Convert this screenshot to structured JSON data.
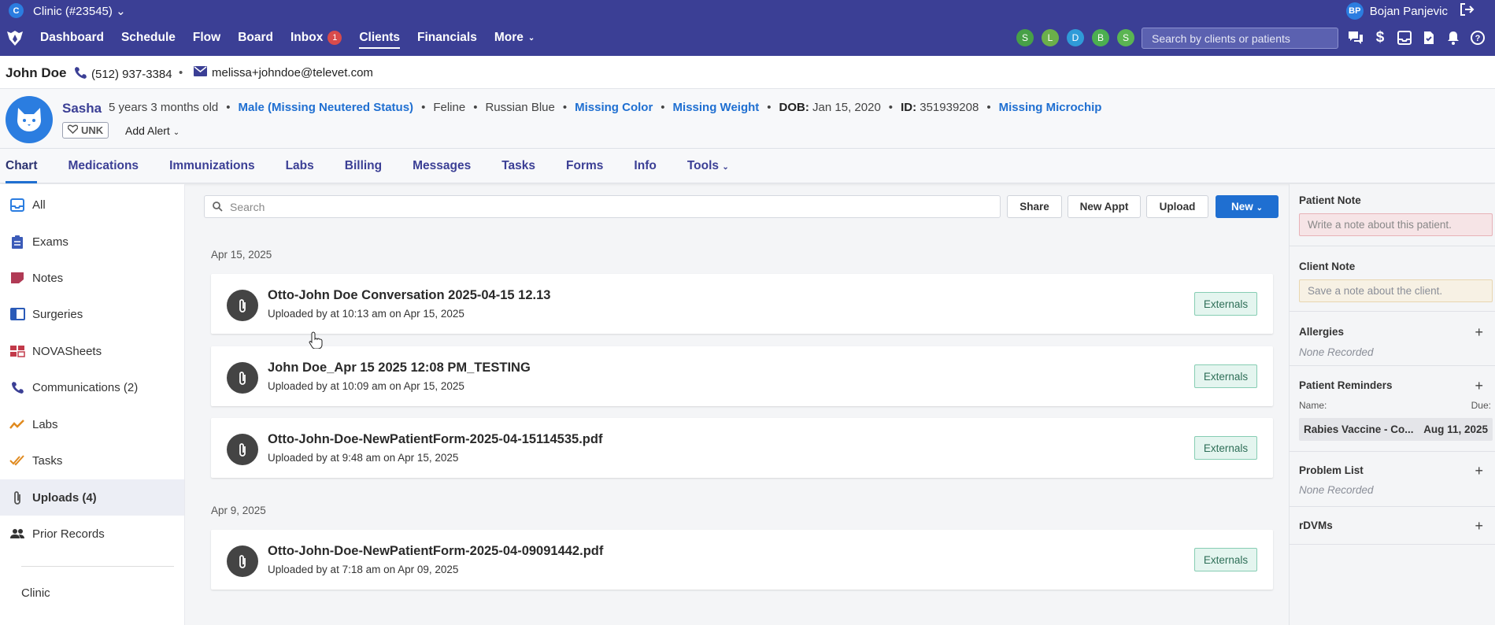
{
  "clinic": {
    "badge": "C",
    "name": "Clinic (#23545)",
    "caret": "⌄"
  },
  "user": {
    "initials": "BP",
    "name": "Bojan Panjevic"
  },
  "nav": {
    "items": [
      "Dashboard",
      "Schedule",
      "Flow",
      "Board",
      "Inbox",
      "Clients",
      "Financials",
      "More"
    ],
    "inbox_count": "1",
    "active": "Clients"
  },
  "staff": [
    {
      "initial": "S",
      "color": "#47a047"
    },
    {
      "initial": "L",
      "color": "#6bb04a"
    },
    {
      "initial": "D",
      "color": "#2f9bd8"
    },
    {
      "initial": "B",
      "color": "#4caf50"
    },
    {
      "initial": "S",
      "color": "#5ab552"
    }
  ],
  "global_search": {
    "placeholder": "Search by clients or patients"
  },
  "client": {
    "name": "John Doe",
    "phone": "(512) 937-3384",
    "email": "melissa+johndoe@televet.com"
  },
  "patient": {
    "name": "Sasha",
    "age": "5 years 3 months old",
    "sex": "Male (Missing Neutered Status)",
    "species": "Feline",
    "breed": "Russian Blue",
    "color": "Missing Color",
    "weight": "Missing Weight",
    "dob_label": "DOB:",
    "dob": "Jan 15, 2020",
    "id_label": "ID:",
    "id": "351939208",
    "microchip": "Missing Microchip",
    "unk": "UNK",
    "add_alert": "Add Alert"
  },
  "tabs": [
    "Chart",
    "Medications",
    "Immunizations",
    "Labs",
    "Billing",
    "Messages",
    "Tasks",
    "Forms",
    "Info",
    "Tools"
  ],
  "sidebar": {
    "items": [
      {
        "label": "All",
        "icon": "inbox-icon"
      },
      {
        "label": "Exams",
        "icon": "clipboard-icon"
      },
      {
        "label": "Notes",
        "icon": "note-icon"
      },
      {
        "label": "Surgeries",
        "icon": "surgery-icon"
      },
      {
        "label": "NOVASheets",
        "icon": "sheets-icon"
      },
      {
        "label": "Communications (2)",
        "icon": "phone-icon"
      },
      {
        "label": "Labs",
        "icon": "labs-chart-icon"
      },
      {
        "label": "Tasks",
        "icon": "double-check-icon"
      },
      {
        "label": "Uploads (4)",
        "icon": "paperclip-icon"
      },
      {
        "label": "Prior Records",
        "icon": "people-icon"
      }
    ],
    "footer": "Clinic"
  },
  "main": {
    "search_placeholder": "Search",
    "buttons": {
      "share": "Share",
      "new_appt": "New Appt",
      "upload": "Upload",
      "new": "New"
    },
    "groups": [
      {
        "date": "Apr 15, 2025",
        "items": [
          {
            "title": "Otto-John Doe Conversation 2025-04-15 12.13",
            "subtitle": "Uploaded by at 10:13 am on Apr 15, 2025",
            "action": "Externals"
          },
          {
            "title": "John Doe_Apr 15 2025 12:08 PM_TESTING",
            "subtitle": "Uploaded by at 10:09 am on Apr 15, 2025",
            "action": "Externals"
          },
          {
            "title": "Otto-John-Doe-NewPatientForm-2025-04-15114535.pdf",
            "subtitle": "Uploaded by at 9:48 am on Apr 15, 2025",
            "action": "Externals"
          }
        ]
      },
      {
        "date": "Apr 9, 2025",
        "items": [
          {
            "title": "Otto-John-Doe-NewPatientForm-2025-04-09091442.pdf",
            "subtitle": "Uploaded by at 7:18 am on Apr 09, 2025",
            "action": "Externals"
          }
        ]
      }
    ]
  },
  "right_panel": {
    "patient_note": {
      "title": "Patient Note",
      "placeholder": "Write a note about this patient."
    },
    "client_note": {
      "title": "Client Note",
      "placeholder": "Save a note about the client."
    },
    "allergies": {
      "title": "Allergies",
      "empty": "None Recorded"
    },
    "reminders": {
      "title": "Patient Reminders",
      "name_label": "Name:",
      "due_label": "Due:",
      "item_name": "Rabies Vaccine - Co...",
      "item_due": "Aug 11, 2025"
    },
    "problem_list": {
      "title": "Problem List",
      "empty": "None Recorded"
    },
    "rdvms": {
      "title": "rDVMs"
    }
  }
}
